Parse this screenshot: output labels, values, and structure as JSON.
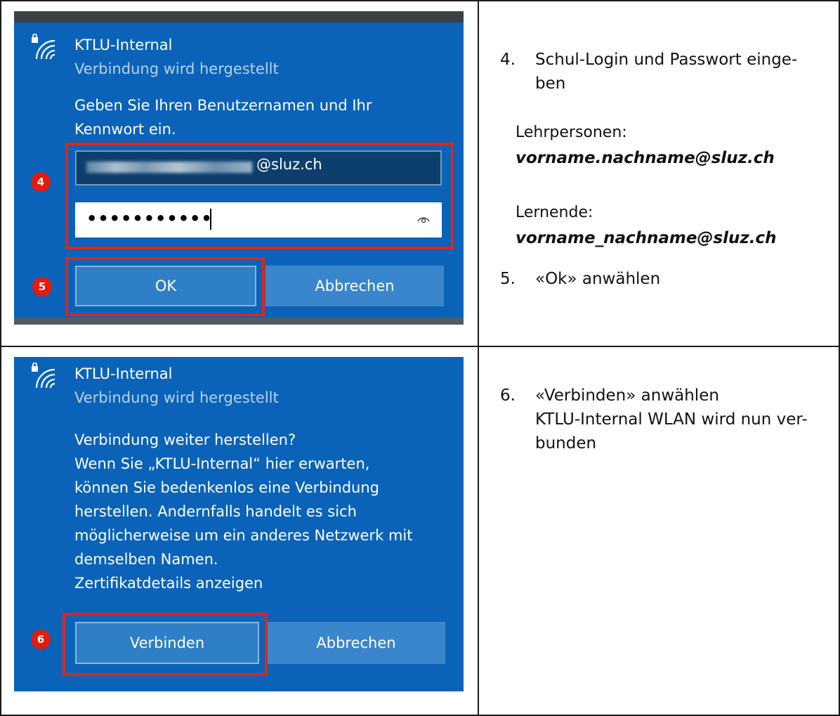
{
  "colors": {
    "panel_blue": "#0a63b8",
    "highlight_red": "#e2231a",
    "badge_red": "#e21b0c"
  },
  "icons": {
    "network": "wifi-lock-icon",
    "reveal": "eye-icon"
  },
  "row1": {
    "dialog": {
      "network_name": "KTLU-Internal",
      "status": "Verbindung wird hergestellt",
      "prompt_line1": "Geben Sie Ihren Benutzernamen und Ihr",
      "prompt_line2": "Kennwort ein.",
      "username_suffix": "@sluz.ch",
      "password_mask": "•••••••••••",
      "ok_label": "OK",
      "cancel_label": "Abbrechen",
      "badge_fields": "4",
      "badge_ok": "5"
    },
    "instructions": {
      "step4_number": "4.",
      "step4_line1": "Schul-Login und Passwort einge-",
      "step4_line2": "ben",
      "teachers_label": "Lehrpersonen:",
      "teachers_format": "vorname.nachname@sluz.ch",
      "students_label": "Lernende:",
      "students_format": "vorname_nachname@sluz.ch",
      "step5_number": "5.",
      "step5_text": "«Ok» anwählen"
    }
  },
  "row2": {
    "dialog": {
      "network_name": "KTLU-Internal",
      "status": "Verbindung wird hergestellt",
      "message_lines": [
        "Verbindung weiter herstellen?",
        "Wenn Sie „KTLU-Internal“ hier erwarten,",
        "können Sie bedenkenlos eine Verbindung",
        "herstellen. Andernfalls handelt es sich",
        "möglicherweise um ein anderes Netzwerk mit",
        "demselben Namen.",
        "Zertifikatdetails anzeigen"
      ],
      "connect_label": "Verbinden",
      "cancel_label": "Abbrechen",
      "badge_connect": "6"
    },
    "instructions": {
      "step6_number": "6.",
      "step6_line1": "«Verbinden» anwählen",
      "step6_line2": "KTLU-Internal WLAN wird nun ver-",
      "step6_line3": "bunden"
    }
  }
}
